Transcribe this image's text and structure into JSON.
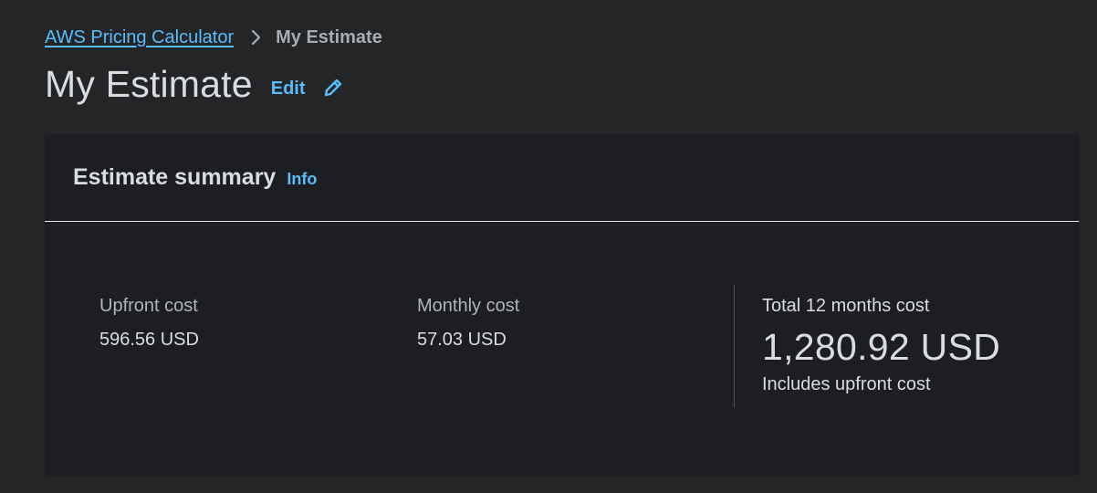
{
  "breadcrumb": {
    "root": "AWS Pricing Calculator",
    "current": "My Estimate"
  },
  "header": {
    "title": "My Estimate",
    "edit_label": "Edit",
    "edit_icon": "pencil-icon"
  },
  "summary": {
    "title": "Estimate summary",
    "info_label": "Info",
    "upfront": {
      "label": "Upfront cost",
      "value": "596.56 USD"
    },
    "monthly": {
      "label": "Monthly cost",
      "value": "57.03 USD"
    },
    "total": {
      "label": "Total 12 months cost",
      "value": "1,280.92 USD",
      "note": "Includes upfront cost"
    }
  },
  "colors": {
    "background": "#232526",
    "card": "#1c1e21",
    "link": "#59bdfd",
    "text": "#d9dde2",
    "muted": "#a8adb4"
  }
}
